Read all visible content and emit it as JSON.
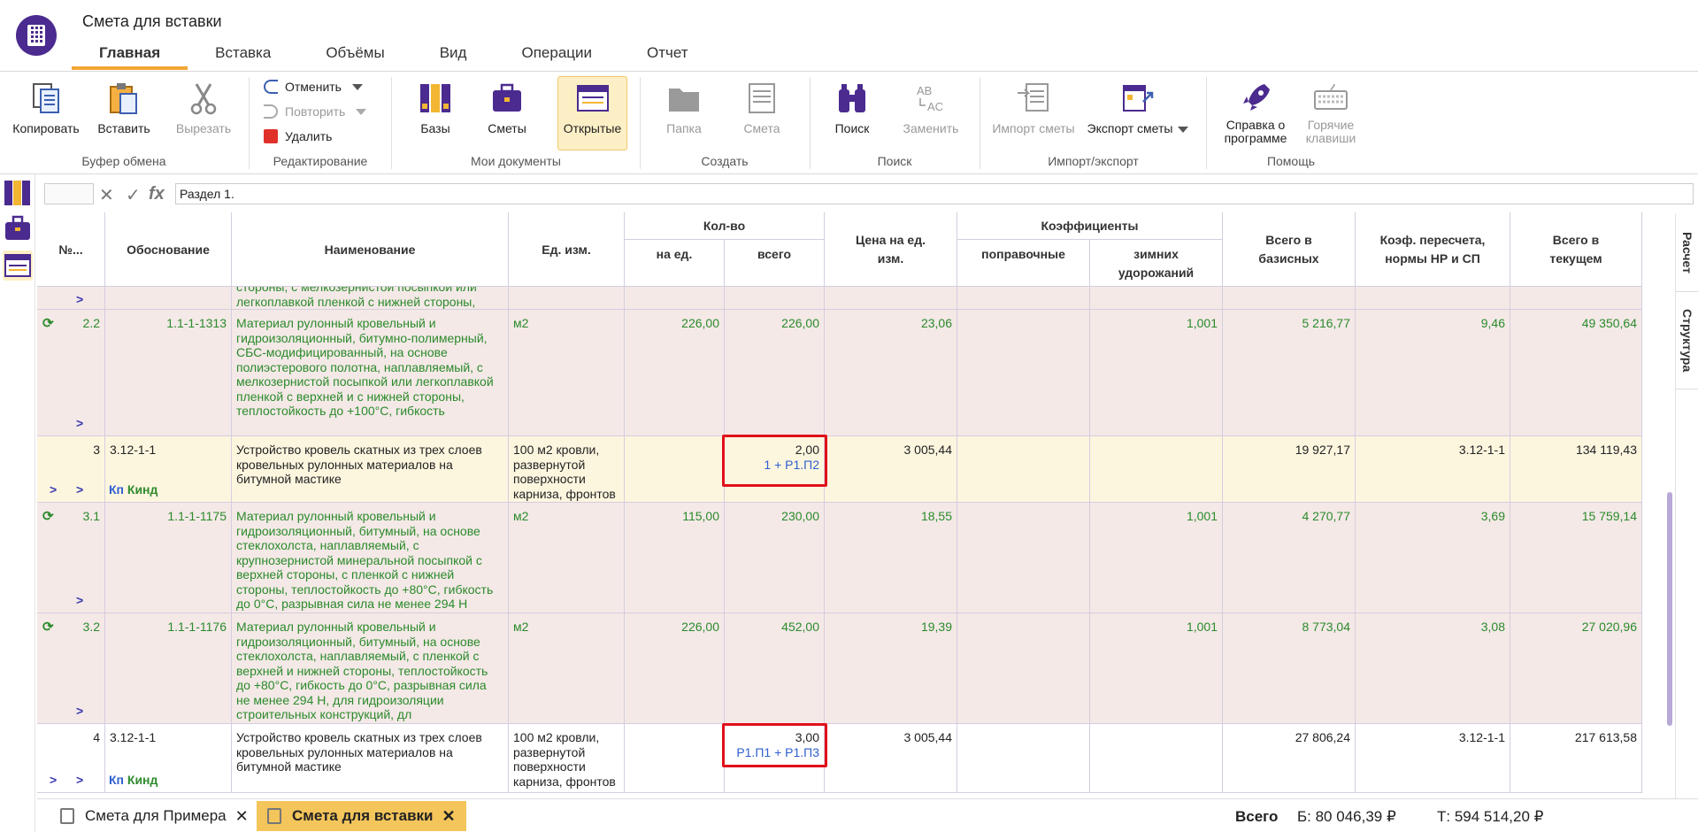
{
  "window": {
    "title": "Смета для вставки"
  },
  "tabs": [
    "Главная",
    "Вставка",
    "Объёмы",
    "Вид",
    "Операции",
    "Отчет"
  ],
  "ribbon": {
    "clipboard": {
      "label": "Буфер обмена",
      "copy": "Копировать",
      "paste": "Вставить",
      "cut": "Вырезать"
    },
    "editing": {
      "label": "Редактирование",
      "undo": "Отменить",
      "redo": "Повторить",
      "delete": "Удалить"
    },
    "my_docs": {
      "label": "Мои документы",
      "bases": "Базы",
      "estimates": "Сметы",
      "open": "Открытые"
    },
    "create": {
      "label": "Создать",
      "folder": "Папка",
      "estimate": "Смета"
    },
    "search": {
      "label": "Поиск",
      "find": "Поиск",
      "replace": "Заменить"
    },
    "import_export": {
      "label": "Импорт/экспорт",
      "import": "Импорт сметы",
      "export": "Экспорт сметы"
    },
    "help": {
      "label": "Помощь",
      "about_1": "Справка о",
      "about_2": "программе",
      "hotkeys_1": "Горячие",
      "hotkeys_2": "клавиши"
    }
  },
  "formula_bar": {
    "cell_ref": "",
    "value": "Раздел 1.",
    "fx": "fx"
  },
  "table": {
    "headers": {
      "num": "№...",
      "basis": "Обоснование",
      "name": "Наименование",
      "unit": "Ед. изм.",
      "qty": "Кол-во",
      "qty_per": "на ед.",
      "qty_total": "всего",
      "price": "Цена на ед. изм.",
      "coefs": "Коэффициенты",
      "coef_corr": "поправочные",
      "coef_winter": "зимних удорожаний",
      "total_base": "Всего в базисных",
      "recalc": "Коэф. пересчета, нормы НР и СП",
      "total_cur": "Всего в текущем"
    },
    "partial_row": {
      "name": "стороны, с мелкозернистой посыпкой или легкоплавкой пленкой с нижней стороны,"
    },
    "rows": [
      {
        "type": "mat",
        "num": "2.2",
        "basis": "1.1-1-1313",
        "name": "Материал рулонный кровельный и гидроизоляционный, битумно-полимерный, СБС-модифицированный, на основе полиэстерового полотна, наплавляемый, с мелкозернистой посыпкой или легкоплавкой пленкой с верхней и с нижней стороны, теплостойкость до +100°С, гибкость",
        "unit": "м2",
        "qty_per": "226,00",
        "qty_total": "226,00",
        "formula": "",
        "price": "23,06",
        "coef_corr": "",
        "coef_winter": "1,001",
        "total_base": "5 216,77",
        "recalc": "9,46",
        "total_cur": "49 350,64"
      },
      {
        "type": "work",
        "num": "3",
        "basis": "3.12-1-1",
        "name": "Устройство кровель скатных из трех слоев кровельных рулонных материалов на битумной мастике",
        "unit": "100 м2 кровли, развернутой поверхности карниза, фронтов",
        "qty_per": "",
        "qty_total": "2,00",
        "formula": "1 + Р1.П2",
        "price": "3 005,44",
        "coef_corr": "",
        "coef_winter": "",
        "total_base": "19 927,17",
        "recalc": "3.12-1-1",
        "total_cur": "134 119,43"
      },
      {
        "type": "mat",
        "num": "3.1",
        "basis": "1.1-1-1175",
        "name": "Материал рулонный кровельный и гидроизоляционный, битумный, на основе стеклохолста, наплавляемый, с крупнозернистой минеральной посыпкой с верхней стороны, с пленкой с нижней стороны, теплостойкость до +80°С, гибкость до 0°С, разрывная сила не менее 294 Н",
        "unit": "м2",
        "qty_per": "115,00",
        "qty_total": "230,00",
        "formula": "",
        "price": "18,55",
        "coef_corr": "",
        "coef_winter": "1,001",
        "total_base": "4 270,77",
        "recalc": "3,69",
        "total_cur": "15 759,14"
      },
      {
        "type": "mat",
        "num": "3.2",
        "basis": "1.1-1-1176",
        "name": "Материал рулонный кровельный и гидроизоляционный, битумный, на основе стеклохолста, наплавляемый, с пленкой с верхней и нижней стороны, теплостойкость до +80°С, гибкость до 0°С, разрывная сила не менее 294 Н, для гидроизоляции строительных конструкций, дл",
        "unit": "м2",
        "qty_per": "226,00",
        "qty_total": "452,00",
        "formula": "",
        "price": "19,39",
        "coef_corr": "",
        "coef_winter": "1,001",
        "total_base": "8 773,04",
        "recalc": "3,08",
        "total_cur": "27 020,96"
      },
      {
        "type": "work",
        "num": "4",
        "basis": "3.12-1-1",
        "name": "Устройство кровель скатных из трех слоев кровельных рулонных материалов на битумной мастике",
        "unit": "100 м2 кровли, развернутой поверхности карниза, фронтов",
        "qty_per": "",
        "qty_total": "3,00",
        "formula": "Р1.П1 + Р1.П3",
        "price": "3 005,44",
        "coef_corr": "",
        "coef_winter": "",
        "total_base": "27 806,24",
        "recalc": "3.12-1-1",
        "total_cur": "217 613,58"
      }
    ],
    "k_labels": {
      "kp": "Кп",
      "kind": "Кинд"
    }
  },
  "side_tabs": {
    "calc": "Расчет",
    "structure": "Структура"
  },
  "doc_tabs": [
    {
      "label": "Смета для Примера",
      "active": false
    },
    {
      "label": "Смета для вставки",
      "active": true
    }
  ],
  "totals": {
    "label": "Всего",
    "base": "Б: 80 046,39 ₽",
    "current": "Т: 594 514,20 ₽"
  },
  "colors": {
    "accent": "#f2a735",
    "material_row": "#f4e9e7",
    "work_row": "#fdf6df",
    "green_text": "#2b8a2b",
    "highlight": "#e0101a",
    "brand": "#4b2b8f"
  }
}
